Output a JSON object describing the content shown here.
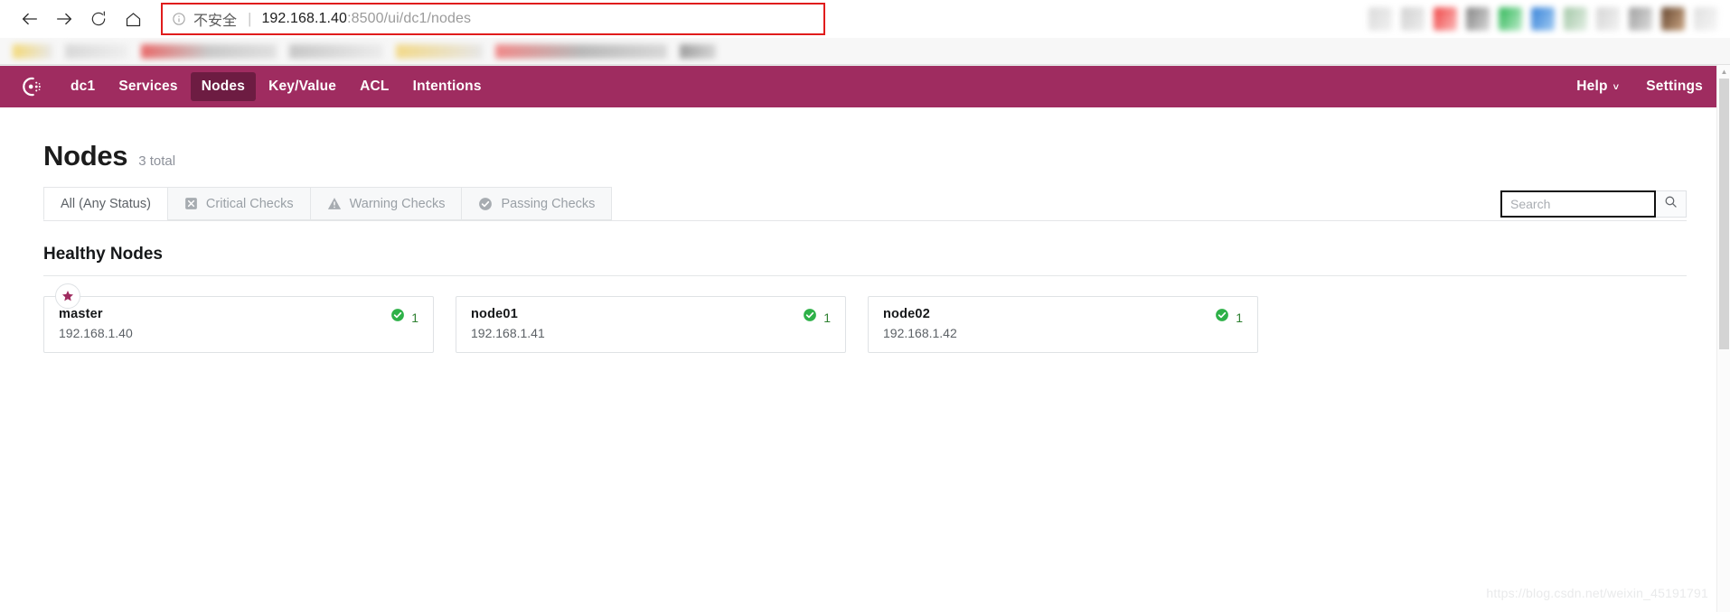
{
  "browser": {
    "back_icon": "arrow-left-icon",
    "forward_icon": "arrow-right-icon",
    "reload_icon": "reload-icon",
    "home_icon": "home-icon",
    "security_icon": "info-circle-icon",
    "security_label": "不安全",
    "divider": "|",
    "url_host": "192.168.1.40",
    "url_path": ":8500/ui/dc1/nodes",
    "highlight_color": "#e01c1c"
  },
  "nav": {
    "logo_name": "consul-logo",
    "items": [
      {
        "label": "dc1",
        "active": false
      },
      {
        "label": "Services",
        "active": false
      },
      {
        "label": "Nodes",
        "active": true
      },
      {
        "label": "Key/Value",
        "active": false
      },
      {
        "label": "ACL",
        "active": false
      },
      {
        "label": "Intentions",
        "active": false
      }
    ],
    "help_label": "Help",
    "help_caret": "˅",
    "settings_label": "Settings",
    "bg_color": "#9f2c60",
    "active_bg_color": "#6d1c42"
  },
  "page": {
    "title": "Nodes",
    "total": "3 total",
    "filters": [
      {
        "label": "All (Any Status)",
        "icon": "",
        "active": true
      },
      {
        "label": "Critical Checks",
        "icon": "critical-x-icon",
        "active": false
      },
      {
        "label": "Warning Checks",
        "icon": "warning-triangle-icon",
        "active": false
      },
      {
        "label": "Passing Checks",
        "icon": "passing-check-icon",
        "active": false
      }
    ],
    "search": {
      "value": "",
      "placeholder": "Search",
      "button_icon": "search-icon"
    },
    "section_title": "Healthy Nodes",
    "nodes": [
      {
        "name": "master",
        "address": "192.168.1.40",
        "checks_passing": "1",
        "leader": true,
        "leader_icon": "star-icon",
        "status_icon": "check-circle-icon"
      },
      {
        "name": "node01",
        "address": "192.168.1.41",
        "checks_passing": "1",
        "leader": false,
        "status_icon": "check-circle-icon"
      },
      {
        "name": "node02",
        "address": "192.168.1.42",
        "checks_passing": "1",
        "leader": false,
        "status_icon": "check-circle-icon"
      }
    ],
    "status_color": "#2eb148",
    "watermark": "https://blog.csdn.net/weixin_45191791"
  }
}
